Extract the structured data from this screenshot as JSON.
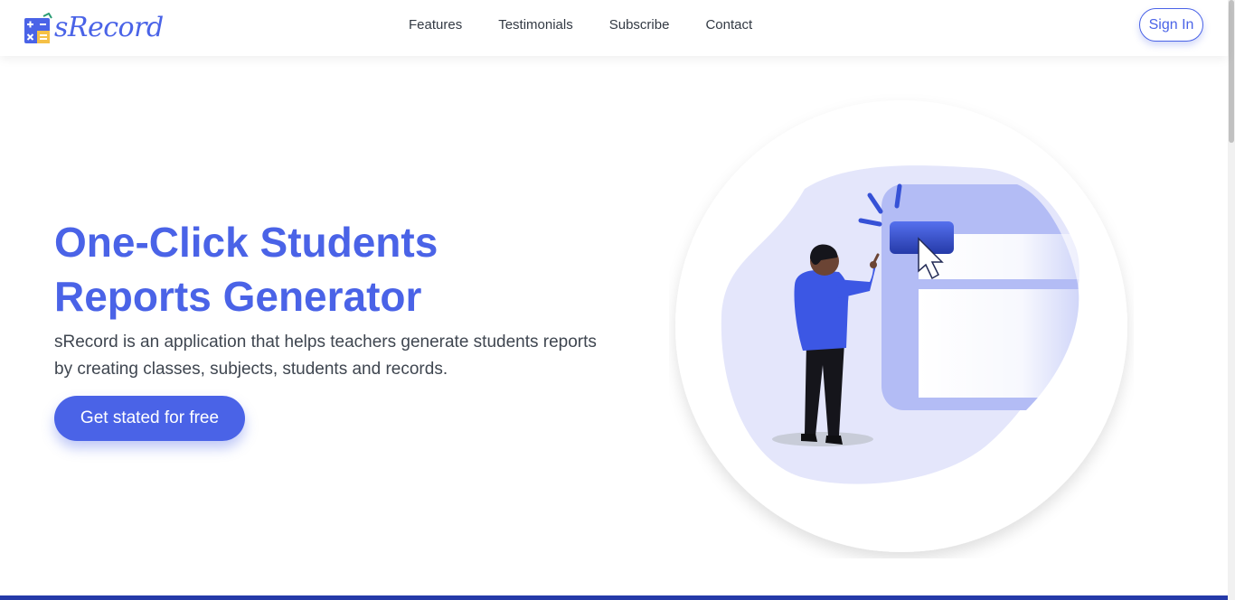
{
  "brand": {
    "name": "sRecord",
    "logo_icon": "calculator-icon"
  },
  "nav": {
    "links": [
      "Features",
      "Testimonials",
      "Subscribe",
      "Contact"
    ],
    "signin_label": "Sign In"
  },
  "hero": {
    "title_line1": "One-Click Students",
    "title_line2": "Reports Generator",
    "description": "sRecord is an application that helps teachers generate students reports by creating classes, subjects, students and records.",
    "cta_label": "Get stated for free",
    "illustration": "person-clicking-button-illustration"
  },
  "colors": {
    "accent": "#4a63e7",
    "blob": "#e4e6fb",
    "panel": "#b3bcf5",
    "bottom_bar": "#253aa8"
  }
}
